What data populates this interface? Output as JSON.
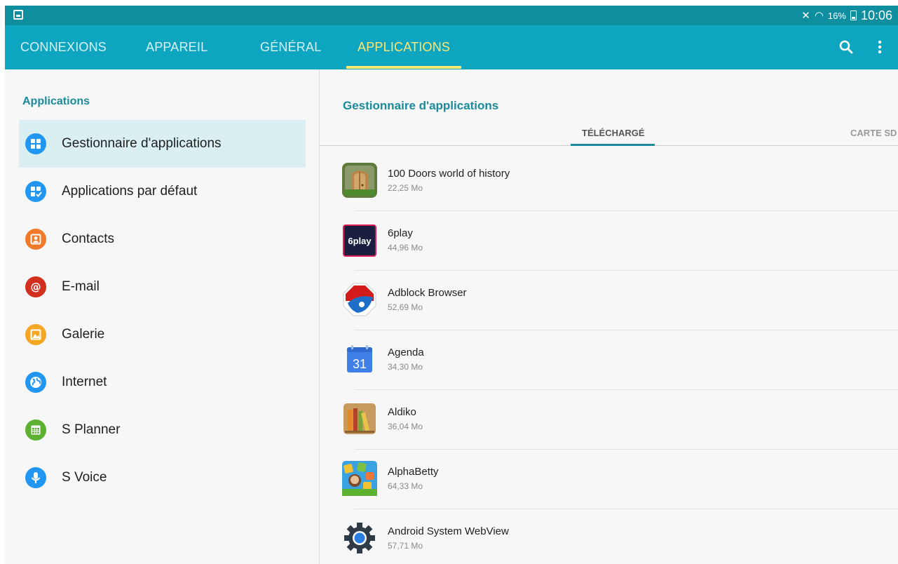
{
  "status_bar": {
    "battery": "16%",
    "time": "10:06",
    "icons": [
      "screenshot-notification-icon",
      "mute-icon",
      "wifi-icon",
      "battery-charging-icon"
    ]
  },
  "top_tabs": [
    {
      "label": "CONNEXIONS",
      "active": false
    },
    {
      "label": "APPAREIL",
      "active": false
    },
    {
      "label": "GÉNÉRAL",
      "active": false
    },
    {
      "label": "APPLICATIONS",
      "active": true
    }
  ],
  "toolbar": {
    "icons": [
      "search-icon",
      "more-options-icon"
    ]
  },
  "left_panel": {
    "title": "Applications",
    "items": [
      {
        "label": "Gestionnaire d'applications",
        "icon": "app-manager-icon",
        "color": "#2196f3",
        "selected": true
      },
      {
        "label": "Applications par défaut",
        "icon": "default-apps-icon",
        "color": "#2196f3",
        "selected": false
      },
      {
        "label": "Contacts",
        "icon": "contacts-icon",
        "color": "#f07a2a",
        "selected": false
      },
      {
        "label": "E-mail",
        "icon": "email-icon",
        "color": "#d32f1e",
        "selected": false
      },
      {
        "label": "Galerie",
        "icon": "gallery-icon",
        "color": "#f5a623",
        "selected": false
      },
      {
        "label": "Internet",
        "icon": "internet-icon",
        "color": "#2196f3",
        "selected": false
      },
      {
        "label": "S Planner",
        "icon": "s-planner-icon",
        "color": "#5cb130",
        "selected": false
      },
      {
        "label": "S Voice",
        "icon": "s-voice-icon",
        "color": "#2196f3",
        "selected": false
      }
    ]
  },
  "right_panel": {
    "title": "Gestionnaire d'applications",
    "subtabs": [
      {
        "label": "TÉLÉCHARGÉ",
        "active": true
      },
      {
        "label": "CARTE SD",
        "active": false
      }
    ],
    "apps": [
      {
        "name": "100 Doors world of history",
        "size": "22,25 Mo",
        "icon": "100-doors-app-icon"
      },
      {
        "name": "6play",
        "size": "44,96 Mo",
        "icon": "6play-app-icon"
      },
      {
        "name": "Adblock Browser",
        "size": "52,69 Mo",
        "icon": "adblock-browser-app-icon"
      },
      {
        "name": "Agenda",
        "size": "34,30 Mo",
        "icon": "agenda-app-icon"
      },
      {
        "name": "Aldiko",
        "size": "36,04 Mo",
        "icon": "aldiko-app-icon"
      },
      {
        "name": "AlphaBetty",
        "size": "64,33 Mo",
        "icon": "alphabetty-app-icon"
      },
      {
        "name": "Android System WebView",
        "size": "57,71 Mo",
        "icon": "android-webview-app-icon"
      }
    ],
    "agenda_icon_text": "31",
    "sixplay_icon_text": "6play"
  }
}
